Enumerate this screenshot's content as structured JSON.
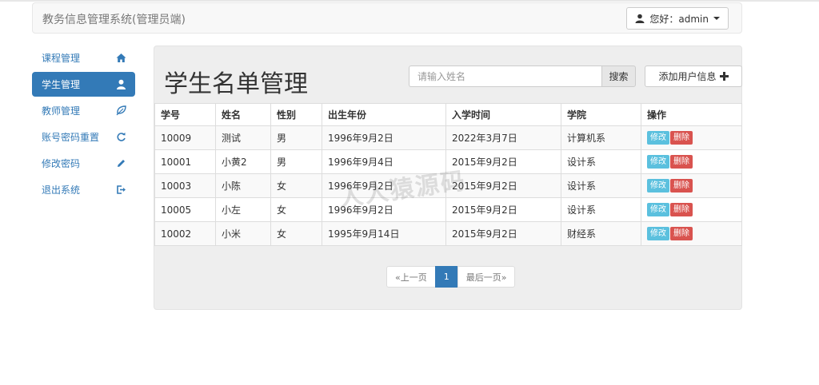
{
  "header": {
    "brand": "教务信息管理系统(管理员端)",
    "user_greeting": "您好：admin"
  },
  "sidebar": {
    "items": [
      {
        "label": "课程管理",
        "icon": "home-icon"
      },
      {
        "label": "学生管理",
        "icon": "user-icon",
        "active": true
      },
      {
        "label": "教师管理",
        "icon": "leaf-icon"
      },
      {
        "label": "账号密码重置",
        "icon": "refresh-icon"
      },
      {
        "label": "修改密码",
        "icon": "pencil-icon"
      },
      {
        "label": "退出系统",
        "icon": "logout-icon"
      }
    ]
  },
  "main": {
    "title": "学生名单管理",
    "search": {
      "placeholder": "请输入姓名",
      "value": "",
      "button_label": "搜索"
    },
    "add_button_label": "添加用户信息",
    "table": {
      "columns": [
        "学号",
        "姓名",
        "性别",
        "出生年份",
        "入学时间",
        "学院",
        "操作"
      ],
      "rows": [
        {
          "id": "10009",
          "name": "测试",
          "gender": "男",
          "birth": "1996年9月2日",
          "enroll": "2022年3月7日",
          "college": "计算机系"
        },
        {
          "id": "10001",
          "name": "小黄2",
          "gender": "男",
          "birth": "1996年9月4日",
          "enroll": "2015年9月2日",
          "college": "设计系"
        },
        {
          "id": "10003",
          "name": "小陈",
          "gender": "女",
          "birth": "1996年9月2日",
          "enroll": "2015年9月2日",
          "college": "设计系"
        },
        {
          "id": "10005",
          "name": "小左",
          "gender": "女",
          "birth": "1996年9月2日",
          "enroll": "2015年9月2日",
          "college": "设计系"
        },
        {
          "id": "10002",
          "name": "小米",
          "gender": "女",
          "birth": "1995年9月14日",
          "enroll": "2015年9月2日",
          "college": "财经系"
        }
      ],
      "edit_label": "修改",
      "delete_label": "删除"
    },
    "pagination": {
      "prev": "«上一页",
      "current": "1",
      "last": "最后一页»"
    }
  },
  "watermark": "人人猿源码",
  "colors": {
    "primary": "#337ab7",
    "info": "#5bc0de",
    "danger": "#d9534f",
    "panel_bg": "#eeeeee"
  }
}
